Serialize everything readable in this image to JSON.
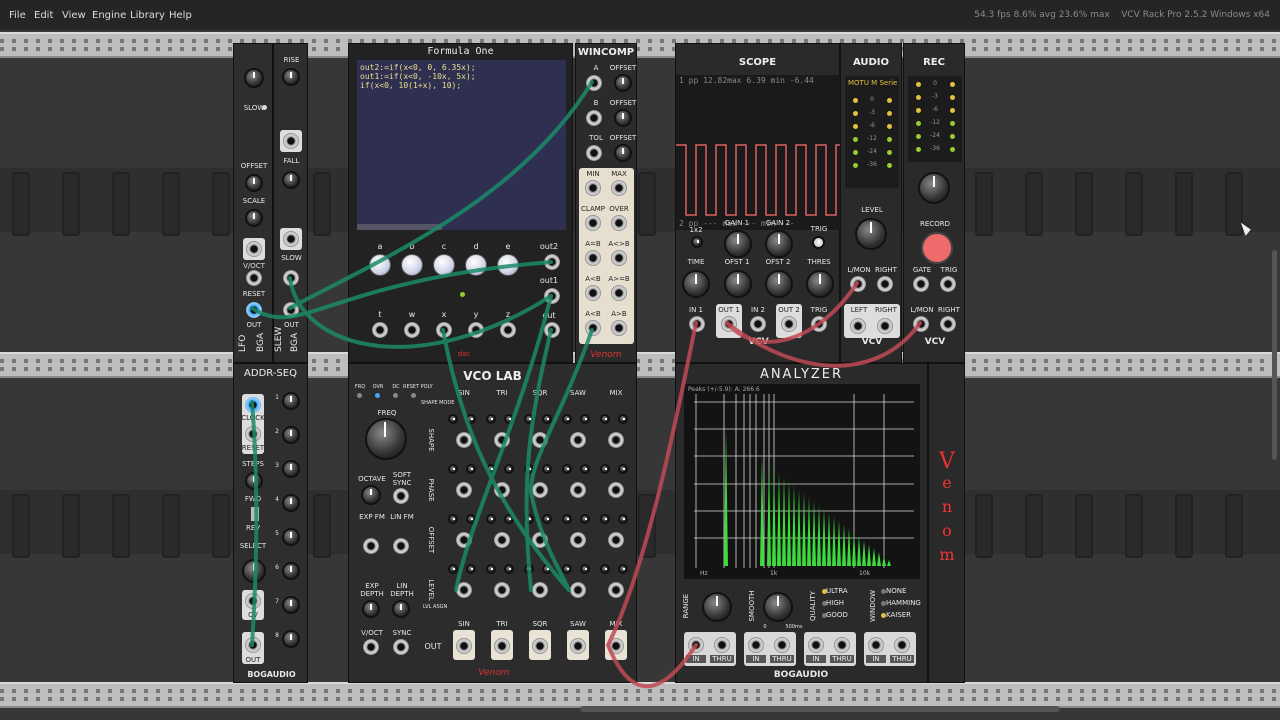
{
  "menu": {
    "items": [
      "File",
      "Edit",
      "View",
      "Engine",
      "Library",
      "Help"
    ],
    "stats": "54.3 fps  8.6% avg  23.6% max",
    "app_title": "VCV Rack Pro 2.5.2 Windows x64"
  },
  "modules": {
    "lfo": {
      "title": "LFO",
      "labels": {
        "rise": "RISE",
        "slow": "SLOW",
        "offset": "OFFSET",
        "scale": "SCALE",
        "fall": "FALL",
        "slow2": "SLOW",
        "voct": "V/OCT",
        "reset": "RESET",
        "out": "OUT",
        "bga": "BGA",
        "slew": "SLEW",
        "out2": "OUT",
        "bga2": "BGA"
      }
    },
    "formula": {
      "title": "Formula One",
      "code": [
        "out2:=if(x<0, 0, 6.35x);",
        "out1:=if(x<0, -10x, 5x);",
        "if(x<0, 10(1+x), 10);"
      ],
      "knob_labels": [
        "a",
        "b",
        "c",
        "d",
        "e"
      ],
      "jack_labels": [
        "t",
        "w",
        "x",
        "y",
        "z"
      ],
      "outputs": [
        "out2",
        "out1",
        "out"
      ],
      "brand": "dac"
    },
    "wincomp": {
      "title": "WINCOMP",
      "labels": [
        "A",
        "OFFSET",
        "B",
        "OFFSET",
        "TOL",
        "OFFSET",
        "MIN",
        "MAX",
        "CLAMP",
        "OVER",
        "A=B",
        "A<>B",
        "A<B",
        "A>=B",
        "A<B",
        "A>B"
      ],
      "brand": "Venom"
    },
    "scope": {
      "title": "SCOPE",
      "top_readout": "1  pp  12.82max  6.39 min  -6.44",
      "bottom_readout": "2  pp   ---  max   ---  min  ---",
      "labels": {
        "x1x2": "1x2",
        "gain1": "GAIN 1",
        "gain2": "GAIN 2",
        "trig": "TRIG",
        "time": "TIME",
        "ofst1": "OFST 1",
        "ofst2": "OFST 2",
        "thres": "THRES",
        "in1": "IN 1",
        "out1": "OUT 1",
        "in2": "IN 2",
        "out2": "OUT 2",
        "trig2": "TRIG"
      },
      "brand": "VCV"
    },
    "audio": {
      "title": "AUDIO",
      "device": "MOTU M Serie",
      "meter_values": [
        "0",
        "-3",
        "-6",
        "-12",
        "-24",
        "-36"
      ],
      "labels": {
        "level": "LEVEL",
        "lmon": "L/MON",
        "right": "RIGHT",
        "left": "LEFT",
        "right2": "RIGHT"
      },
      "brand": "VCV"
    },
    "rec": {
      "title": "REC",
      "meter_values": [
        "0",
        "-3",
        "-6",
        "-12",
        "-24",
        "-36"
      ],
      "labels": {
        "record": "RECORD",
        "gate": "GATE",
        "trig": "TRIG",
        "lmon": "L/MON",
        "right": "RIGHT"
      },
      "brand": "VCV"
    },
    "addrseq": {
      "title": "ADDR-SEQ",
      "labels": {
        "clock": "CLOCK",
        "reset": "RESET",
        "steps": "STEPS",
        "fwd": "FWD",
        "rev": "REV",
        "select": "SELECT",
        "cv": "CV",
        "out": "OUT"
      },
      "step_numbers": [
        "1",
        "2",
        "3",
        "4",
        "5",
        "6",
        "7",
        "8"
      ],
      "brand": "BOGAUDIO"
    },
    "vcolab": {
      "title": "VCO LAB",
      "top_labels": [
        "FRQ",
        "OVR",
        "DC",
        "RESET POLY"
      ],
      "wave_columns": [
        "SIN",
        "TRI",
        "SQR",
        "SAW",
        "MIX"
      ],
      "row_labels": [
        "SHAPE",
        "PHASE",
        "OFFSET",
        "LEVEL"
      ],
      "side_labels": {
        "shape_mode": "SHAPE MODE",
        "freq": "FREQ",
        "octave": "OCTAVE",
        "soft_sync": "SOFT SYNC",
        "exp_fm": "EXP FM",
        "lin_fm": "LIN FM",
        "exp_depth": "EXP DEPTH",
        "lin_depth": "LIN DEPTH",
        "voct": "V/OCT",
        "sync": "SYNC",
        "out": "OUT",
        "lvl_asgn": "LVL ASGN"
      },
      "brand": "Venom"
    },
    "analyzer": {
      "title": "ANALYZER",
      "readout": "Peaks (+/-5.9):  A:  266.6",
      "axis_labels": [
        "Hz",
        "1k",
        "10k"
      ],
      "controls": {
        "range": "RANGE",
        "smooth": "SMOOTH",
        "smooth_value": "500ms",
        "smooth_zero": "0",
        "quality": "QUALITY",
        "window": "WINDOW"
      },
      "quality_options": [
        "ULTRA",
        "HIGH",
        "GOOD"
      ],
      "window_options": [
        "NONE",
        "HAMMING",
        "KAISER"
      ],
      "io_labels": [
        "IN",
        "THRU",
        "IN",
        "THRU",
        "IN",
        "THRU",
        "IN",
        "THRU"
      ],
      "brand": "BOGAUDIO"
    },
    "venom_blank": {
      "letters": [
        "V",
        "e",
        "n",
        "o",
        "m"
      ]
    }
  }
}
